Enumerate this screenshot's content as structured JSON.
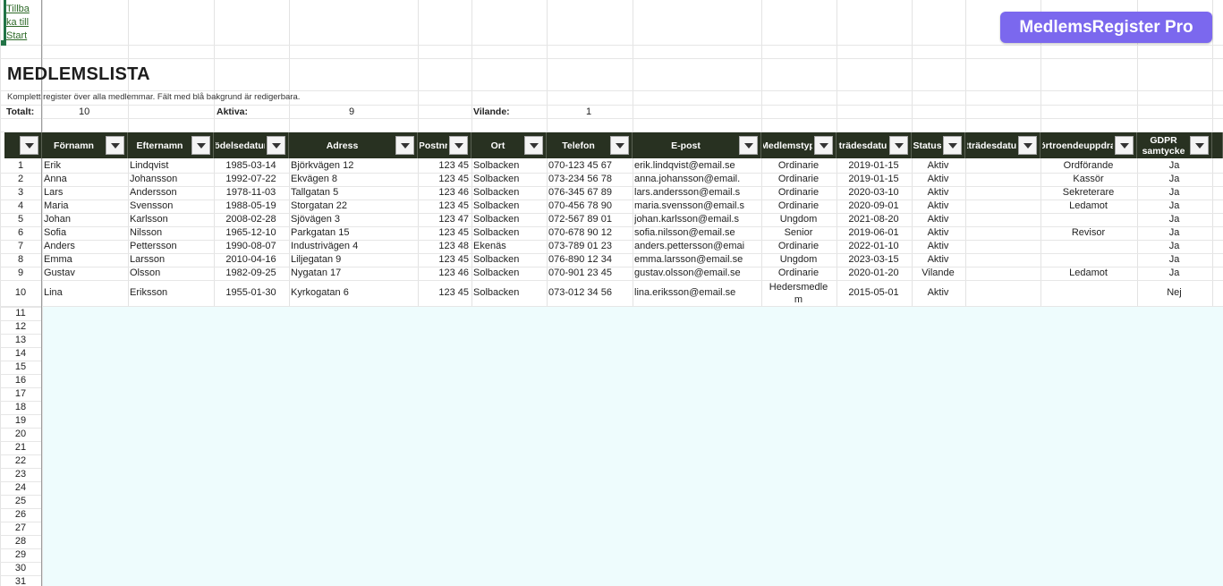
{
  "back_link": {
    "lines": [
      "Tillba",
      "ka till",
      "Start"
    ]
  },
  "brand": {
    "label": "MedlemsRegister Pro",
    "color": "#7b68ee"
  },
  "page": {
    "title": "MEDLEMSLISTA",
    "subtitle": "Komplett register över alla medlemmar. Fält med blå bakgrund är redigerbara."
  },
  "stats": {
    "total_label": "Totalt:",
    "total_value": "10",
    "active_label": "Aktiva:",
    "active_value": "9",
    "dormant_label": "Vilande:",
    "dormant_value": "1"
  },
  "colors": {
    "header_bg": "#283121",
    "editable_bg": "#eefcfd",
    "link": "#2f6b2a"
  },
  "table": {
    "headers": [
      "Förnamn",
      "Efternamn",
      "Födelsedatum",
      "Adress",
      "Postnr",
      "Ort",
      "Telefon",
      "E-post",
      "Medlemstyp",
      "Inträdesdatum",
      "Status",
      "Utträdesdatum",
      "Förtroendeuppdrag",
      "GDPR\nsamtycke"
    ],
    "rows": [
      {
        "n": "1",
        "c": [
          "Erik",
          "Lindqvist",
          "1985-03-14",
          "Björkvägen 12",
          "123 45",
          "Solbacken",
          "070-123 45 67",
          "erik.lindqvist@email.se",
          "Ordinarie",
          "2019-01-15",
          "Aktiv",
          "",
          "Ordförande",
          "Ja"
        ]
      },
      {
        "n": "2",
        "c": [
          "Anna",
          "Johansson",
          "1992-07-22",
          "Ekvägen 8",
          "123 45",
          "Solbacken",
          "073-234 56 78",
          "anna.johansson@email.",
          "Ordinarie",
          "2019-01-15",
          "Aktiv",
          "",
          "Kassör",
          "Ja"
        ]
      },
      {
        "n": "3",
        "c": [
          "Lars",
          "Andersson",
          "1978-11-03",
          "Tallgatan 5",
          "123 46",
          "Solbacken",
          "076-345 67 89",
          "lars.andersson@email.s",
          "Ordinarie",
          "2020-03-10",
          "Aktiv",
          "",
          "Sekreterare",
          "Ja"
        ]
      },
      {
        "n": "4",
        "c": [
          "Maria",
          "Svensson",
          "1988-05-19",
          "Storgatan 22",
          "123 45",
          "Solbacken",
          "070-456 78 90",
          "maria.svensson@email.s",
          "Ordinarie",
          "2020-09-01",
          "Aktiv",
          "",
          "Ledamot",
          "Ja"
        ]
      },
      {
        "n": "5",
        "c": [
          "Johan",
          "Karlsson",
          "2008-02-28",
          "Sjövägen 3",
          "123 47",
          "Solbacken",
          "072-567 89 01",
          "johan.karlsson@email.s",
          "Ungdom",
          "2021-08-20",
          "Aktiv",
          "",
          "",
          "Ja"
        ]
      },
      {
        "n": "6",
        "c": [
          "Sofia",
          "Nilsson",
          "1965-12-10",
          "Parkgatan 15",
          "123 45",
          "Solbacken",
          "070-678 90 12",
          "sofia.nilsson@email.se",
          "Senior",
          "2019-06-01",
          "Aktiv",
          "",
          "Revisor",
          "Ja"
        ]
      },
      {
        "n": "7",
        "c": [
          "Anders",
          "Pettersson",
          "1990-08-07",
          "Industrivägen 4",
          "123 48",
          "Ekenäs",
          "073-789 01 23",
          "anders.pettersson@emai",
          "Ordinarie",
          "2022-01-10",
          "Aktiv",
          "",
          "",
          "Ja"
        ]
      },
      {
        "n": "8",
        "c": [
          "Emma",
          "Larsson",
          "2010-04-16",
          "Liljegatan 9",
          "123 45",
          "Solbacken",
          "076-890 12 34",
          "emma.larsson@email.se",
          "Ungdom",
          "2023-03-15",
          "Aktiv",
          "",
          "",
          "Ja"
        ]
      },
      {
        "n": "9",
        "c": [
          "Gustav",
          "Olsson",
          "1982-09-25",
          "Nygatan 17",
          "123 46",
          "Solbacken",
          "070-901 23 45",
          "gustav.olsson@email.se",
          "Ordinarie",
          "2020-01-20",
          "Vilande",
          "",
          "Ledamot",
          "Ja"
        ]
      },
      {
        "n": "10",
        "c": [
          "Lina",
          "Eriksson",
          "1955-01-30",
          "Kyrkogatan 6",
          "123 45",
          "Solbacken",
          "073-012 34 56",
          "lina.eriksson@email.se",
          "Hedersmedle\nm",
          "2015-05-01",
          "Aktiv",
          "",
          "",
          "Nej"
        ]
      }
    ],
    "empty_rows": [
      "11",
      "12",
      "13",
      "14",
      "15",
      "16",
      "17",
      "18",
      "19",
      "20",
      "21",
      "22",
      "23",
      "24",
      "25",
      "26",
      "27",
      "28",
      "29",
      "30",
      "31"
    ]
  }
}
